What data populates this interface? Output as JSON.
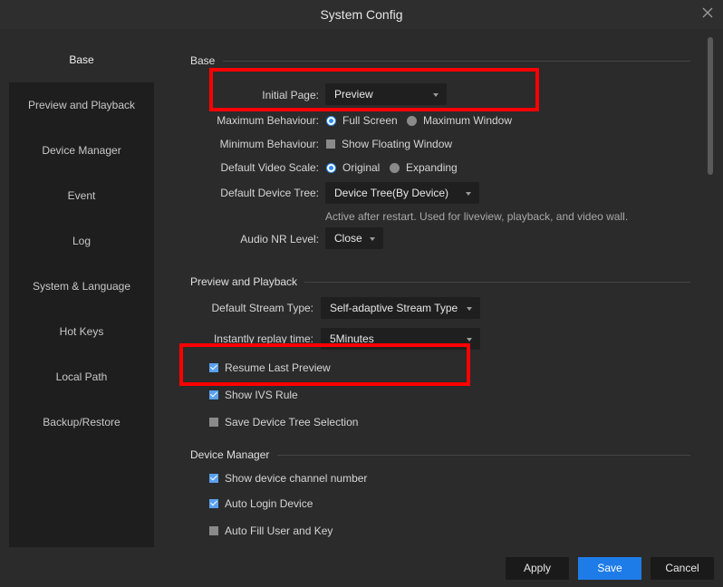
{
  "window": {
    "title": "System Config",
    "close_icon": "close-icon"
  },
  "sidebar": {
    "items": [
      {
        "label": "Base",
        "active": true
      },
      {
        "label": "Preview and Playback"
      },
      {
        "label": "Device Manager"
      },
      {
        "label": "Event"
      },
      {
        "label": "Log"
      },
      {
        "label": "System & Language"
      },
      {
        "label": "Hot Keys"
      },
      {
        "label": "Local Path"
      },
      {
        "label": "Backup/Restore"
      }
    ]
  },
  "base": {
    "heading": "Base",
    "initial_page": {
      "label": "Initial Page:",
      "value": "Preview"
    },
    "maximum_behaviour": {
      "label": "Maximum Behaviour:",
      "options": [
        "Full Screen",
        "Maximum Window"
      ],
      "selected": "Full Screen"
    },
    "minimum_behaviour": {
      "label": "Minimum Behaviour:",
      "option": "Show Floating Window",
      "checked": false
    },
    "default_video_scale": {
      "label": "Default Video Scale:",
      "options": [
        "Original",
        "Expanding"
      ],
      "selected": "Original"
    },
    "default_device_tree": {
      "label": "Default Device Tree:",
      "value": "Device Tree(By Device)",
      "hint": "Active after restart. Used for liveview, playback, and video wall."
    },
    "audio_nr_level": {
      "label": "Audio NR Level:",
      "value": "Close"
    }
  },
  "preview_playback": {
    "heading": "Preview and Playback",
    "default_stream_type": {
      "label": "Default Stream Type:",
      "value": "Self-adaptive Stream Type"
    },
    "instantly_replay_time": {
      "label": "Instantly replay time:",
      "value": "5Minutes"
    },
    "resume_last_preview": {
      "label": "Resume Last Preview",
      "checked": true
    },
    "show_ivs_rule": {
      "label": "Show IVS Rule",
      "checked": true
    },
    "save_device_tree_selection": {
      "label": "Save Device Tree Selection",
      "checked": false
    }
  },
  "device_manager": {
    "heading": "Device Manager",
    "show_device_channel_number": {
      "label": "Show device channel number",
      "checked": true
    },
    "auto_login_device": {
      "label": "Auto Login Device",
      "checked": true
    },
    "auto_fill_user_and_key": {
      "label": "Auto Fill User and Key",
      "checked": false
    }
  },
  "footer": {
    "apply": "Apply",
    "save": "Save",
    "cancel": "Cancel"
  },
  "colors": {
    "accent": "#1e7ce8",
    "highlight": "#ff0000",
    "background": "#2b2b2b",
    "sidebar": "#1e1e1e"
  }
}
